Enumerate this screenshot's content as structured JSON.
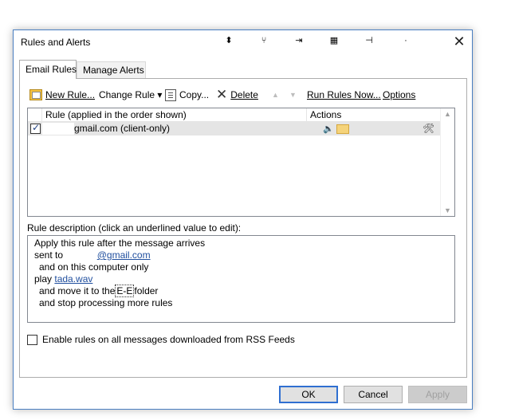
{
  "window": {
    "title": "Rules and Alerts",
    "titlebar_icons": [
      "pin-down-icon",
      "branch-icon",
      "import-icon",
      "grid-icon",
      "pushpin-icon",
      "dot-icon"
    ],
    "close_glyph": "✕"
  },
  "tabs": [
    {
      "label": "Email Rules",
      "active": true
    },
    {
      "label": "Manage Alerts",
      "active": false
    }
  ],
  "toolbar": {
    "new_rule": "New Rule...",
    "change_rule": "Change Rule ▾",
    "copy": "Copy...",
    "delete": "Delete",
    "run_rules_now": "Run Rules Now...",
    "options": "Options"
  },
  "grid": {
    "col_rule": "Rule (applied in the order shown)",
    "col_actions": "Actions",
    "rows": [
      {
        "checked": true,
        "name": "gmail.com  (client-only)"
      }
    ]
  },
  "description": {
    "label": "Rule description (click an underlined value to edit):",
    "line1": "Apply this rule after the message arrives",
    "line2_prefix": "sent to",
    "line2_link": "@gmail.com",
    "line3": "and on this computer only",
    "line4_prefix": "play",
    "line4_link": "tada.wav",
    "line5_prefix": "and move it to the",
    "line5_value": "E-E",
    "line5_suffix": "folder",
    "line6": "and stop processing more rules"
  },
  "rss": {
    "label": "Enable rules on all messages downloaded from RSS Feeds",
    "checked": false
  },
  "buttons": {
    "ok": "OK",
    "cancel": "Cancel",
    "apply": "Apply"
  },
  "colors": {
    "accent": "#2f6fd1",
    "link": "#1f4e9e",
    "row_selected": "#e5e5e5"
  }
}
